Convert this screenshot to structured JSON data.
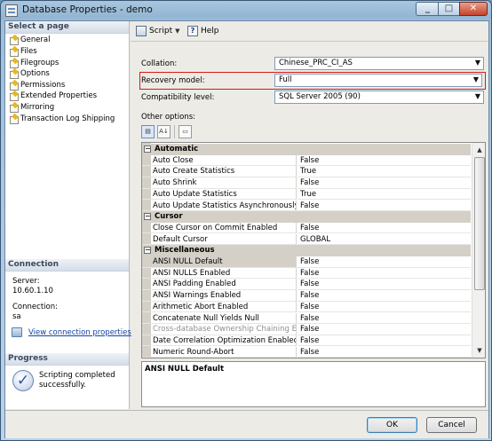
{
  "window": {
    "title": "Database Properties - demo"
  },
  "left": {
    "select_page_header": "Select a page",
    "pages": [
      "General",
      "Files",
      "Filegroups",
      "Options",
      "Permissions",
      "Extended Properties",
      "Mirroring",
      "Transaction Log Shipping"
    ],
    "connection_header": "Connection",
    "server_label": "Server:",
    "server_value": "10.60.1.10",
    "connection_label": "Connection:",
    "connection_value": "sa",
    "view_link": "View connection properties",
    "progress_header": "Progress",
    "progress_status": "Scripting completed successfully."
  },
  "toolbar": {
    "script": "Script",
    "help": "Help"
  },
  "fields": {
    "collation_label": "Collation:",
    "collation_value": "Chinese_PRC_CI_AS",
    "recovery_label": "Recovery model:",
    "recovery_value": "Full",
    "compat_label": "Compatibility level:",
    "compat_value": "SQL Server 2005 (90)",
    "other_options_label": "Other options:"
  },
  "grid": {
    "rows": [
      {
        "cat": "Automatic"
      },
      {
        "k": "Auto Close",
        "v": "False"
      },
      {
        "k": "Auto Create Statistics",
        "v": "True"
      },
      {
        "k": "Auto Shrink",
        "v": "False"
      },
      {
        "k": "Auto Update Statistics",
        "v": "True"
      },
      {
        "k": "Auto Update Statistics Asynchronously",
        "v": "False"
      },
      {
        "cat": "Cursor"
      },
      {
        "k": "Close Cursor on Commit Enabled",
        "v": "False"
      },
      {
        "k": "Default Cursor",
        "v": "GLOBAL"
      },
      {
        "cat": "Miscellaneous"
      },
      {
        "k": "ANSI NULL Default",
        "v": "False",
        "sel": true
      },
      {
        "k": "ANSI NULLS Enabled",
        "v": "False"
      },
      {
        "k": "ANSI Padding Enabled",
        "v": "False"
      },
      {
        "k": "ANSI Warnings Enabled",
        "v": "False"
      },
      {
        "k": "Arithmetic Abort Enabled",
        "v": "False"
      },
      {
        "k": "Concatenate Null Yields Null",
        "v": "False"
      },
      {
        "k": "Cross-database Ownership Chaining Enabled",
        "v": "False",
        "gray": true
      },
      {
        "k": "Date Correlation Optimization Enabled",
        "v": "False"
      },
      {
        "k": "Numeric Round-Abort",
        "v": "False"
      }
    ]
  },
  "description": "ANSI NULL Default",
  "buttons": {
    "ok": "OK",
    "cancel": "Cancel"
  }
}
